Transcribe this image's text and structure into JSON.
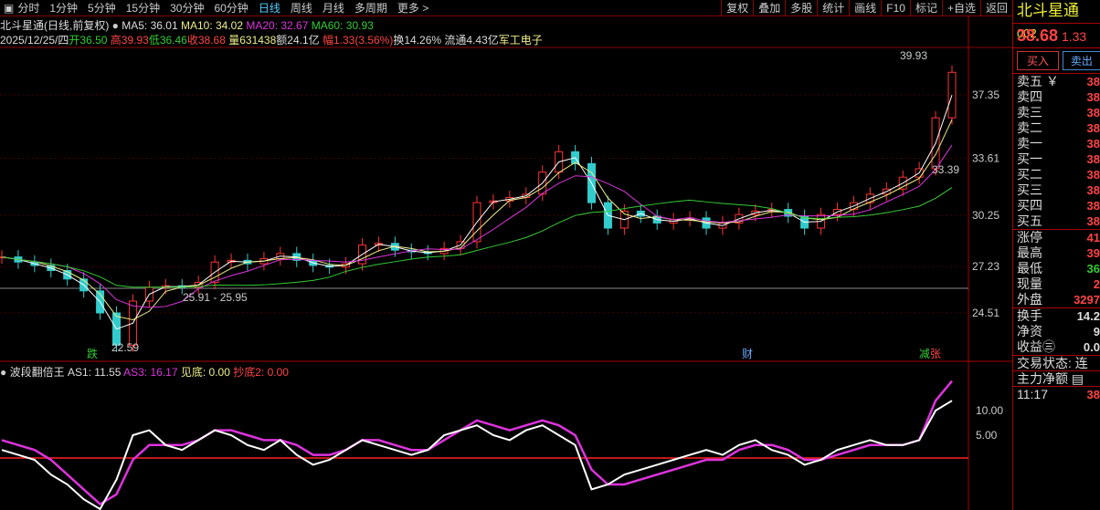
{
  "periods": [
    "分时",
    "1分钟",
    "5分钟",
    "15分钟",
    "30分钟",
    "60分钟",
    "日线",
    "周线",
    "月线",
    "多周期",
    "更多 >"
  ],
  "active_period": "日线",
  "tools": [
    "复权",
    "叠加",
    "多股",
    "统计",
    "画线",
    "F10",
    "标记",
    "+自选",
    "返回"
  ],
  "title": "北斗星通(日线,前复权)",
  "ma": {
    "ma5": "MA5: 36.01",
    "ma10": "MA10: 34.02",
    "ma20": "MA20: 32.67",
    "ma60": "MA60: 30.93"
  },
  "quote": {
    "date": "2025/12/25/四",
    "open": "开36.50",
    "high": "高39.93",
    "low": "低36.46",
    "close": "收38.68",
    "vol": "量631438",
    "amt": "额24.1亿",
    "chg": "幅1.33(3.56%)",
    "turn": "换14.26%",
    "float": "流通4.43亿",
    "sector": "军工电子"
  },
  "price_axis": [
    "37.35",
    "33.61",
    "30.25",
    "27.23",
    "24.51"
  ],
  "indicator_axis": [
    "10.00",
    "5.00"
  ],
  "annotations": {
    "high": "39.93",
    "low": "22.59",
    "range": "25.91 - 25.95",
    "ref": "33.39",
    "mark_die": "跌",
    "mark_cai": "财",
    "mark_jian": "减",
    "mark_zhang": "张"
  },
  "indicator": {
    "name": "波段翻倍王",
    "as1": "AS1: 11.55",
    "as3": "AS3: 16.17",
    "jiandi": "见底: 0.00",
    "chaodi": "抄底2: 0.00"
  },
  "colors": {
    "up": "#ff3333",
    "down": "#33cccc",
    "ma5": "#ffffff",
    "ma10": "#eeee88",
    "ma20": "#dd33dd",
    "ma60": "#33cc33"
  },
  "chart_data": {
    "type": "candlestick",
    "closes": [
      27.8,
      27.5,
      27.3,
      27.0,
      26.5,
      25.8,
      24.5,
      22.6,
      25.2,
      26.0,
      26.1,
      26.0,
      26.3,
      27.5,
      27.6,
      27.4,
      27.7,
      28.0,
      27.6,
      27.3,
      27.2,
      27.4,
      28.5,
      28.6,
      28.2,
      28.1,
      28.0,
      28.3,
      28.7,
      31.0,
      31.1,
      31.3,
      31.5,
      32.8,
      34.0,
      33.3,
      31.0,
      29.5,
      30.5,
      30.2,
      29.8,
      30.0,
      30.1,
      29.5,
      29.8,
      30.3,
      30.5,
      30.6,
      30.2,
      29.5,
      30.3,
      30.6,
      31.0,
      31.5,
      31.8,
      32.5,
      33.0,
      36.0,
      38.68
    ],
    "as1": [
      2,
      1,
      0,
      -3,
      -5,
      -8,
      -10,
      -4,
      5,
      6,
      3,
      2,
      4,
      6,
      5,
      3,
      2,
      4,
      1,
      -1,
      0,
      2,
      4,
      3,
      2,
      1,
      2,
      5,
      6,
      7,
      5,
      4,
      6,
      7,
      5,
      3,
      -6,
      -5,
      -3,
      -2,
      -1,
      0,
      1,
      2,
      1,
      3,
      4,
      2,
      1,
      -1,
      0,
      2,
      3,
      4,
      3,
      3,
      4,
      10,
      12
    ],
    "as3": [
      4,
      3,
      2,
      0,
      -3,
      -6,
      -9,
      -7,
      0,
      3,
      3,
      3,
      4,
      6,
      6,
      5,
      4,
      4,
      3,
      1,
      1,
      2,
      4,
      4,
      3,
      2,
      2,
      4,
      6,
      8,
      7,
      6,
      7,
      8,
      7,
      5,
      -2,
      -5,
      -5,
      -4,
      -3,
      -2,
      -1,
      0,
      0,
      2,
      3,
      3,
      2,
      0,
      0,
      1,
      2,
      3,
      3,
      3,
      4,
      12,
      16
    ]
  },
  "side": {
    "name": "北斗星通",
    "code": "002",
    "price": "38.68",
    "chg": "1.33",
    "buy": "买入",
    "sell": "卖出",
    "book": [
      {
        "l": "卖五 ￥",
        "v": "38"
      },
      {
        "l": "卖四",
        "v": "38"
      },
      {
        "l": "卖三",
        "v": "38"
      },
      {
        "l": "卖二",
        "v": "38"
      },
      {
        "l": "卖一",
        "v": "38"
      },
      {
        "l": "买一",
        "v": "38"
      },
      {
        "l": "买二",
        "v": "38"
      },
      {
        "l": "买三",
        "v": "38"
      },
      {
        "l": "买四",
        "v": "38"
      },
      {
        "l": "买五",
        "v": "38"
      }
    ],
    "stats": [
      {
        "l": "涨停",
        "v": "41"
      },
      {
        "l": "最高",
        "v": "39"
      },
      {
        "l": "最低",
        "v": "36"
      },
      {
        "l": "现量",
        "v": "2"
      },
      {
        "l": "外盘",
        "v": "3297"
      }
    ],
    "stats2": [
      {
        "l": "换手",
        "v": "14.2"
      },
      {
        "l": "净资",
        "v": "9"
      },
      {
        "l": "收益㊂",
        "v": "0.0"
      }
    ],
    "state": "交易状态: 连续",
    "main": "主力净额 ▤",
    "time": "11:17",
    "time_v": "38"
  }
}
